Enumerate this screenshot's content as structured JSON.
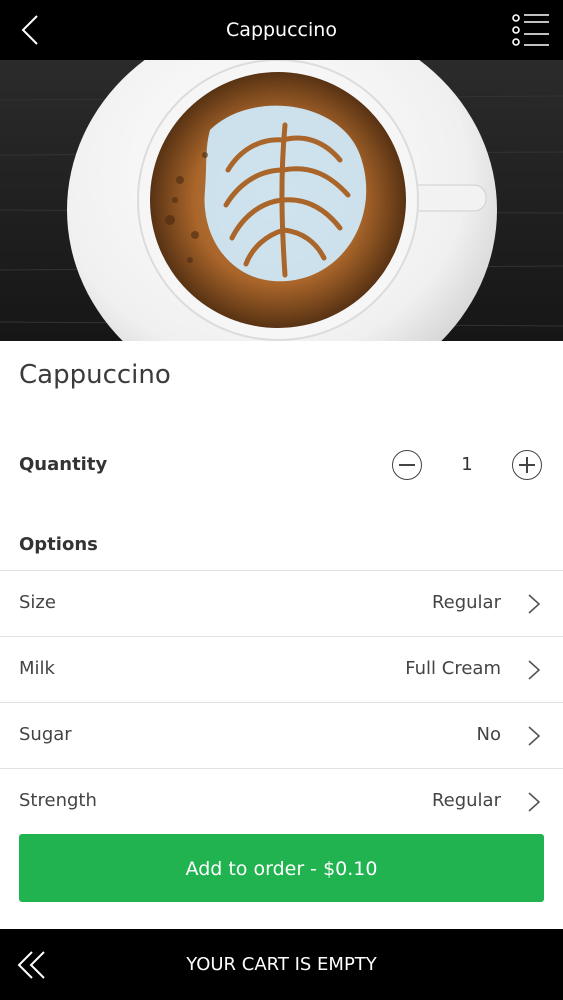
{
  "header": {
    "title": "Cappuccino",
    "back_icon": "chevron-left-icon",
    "menu_icon": "list-menu-icon"
  },
  "hero": {
    "image": "cappuccino-latte-art-cup"
  },
  "product": {
    "name": "Cappuccino",
    "quantity_label": "Quantity",
    "quantity": "1",
    "minus_icon": "minus-circle-icon",
    "plus_icon": "plus-circle-icon"
  },
  "options": {
    "label": "Options",
    "items": [
      {
        "label": "Size",
        "value": "Regular"
      },
      {
        "label": "Milk",
        "value": "Full Cream"
      },
      {
        "label": "Sugar",
        "value": "No"
      },
      {
        "label": "Strength",
        "value": "Regular"
      }
    ]
  },
  "actions": {
    "add_to_order": "Add to order - $0.10"
  },
  "cart": {
    "status": "YOUR CART IS EMPTY",
    "icon": "double-chevron-left-icon"
  },
  "colors": {
    "accent": "#22b351",
    "bars": "#000000"
  }
}
